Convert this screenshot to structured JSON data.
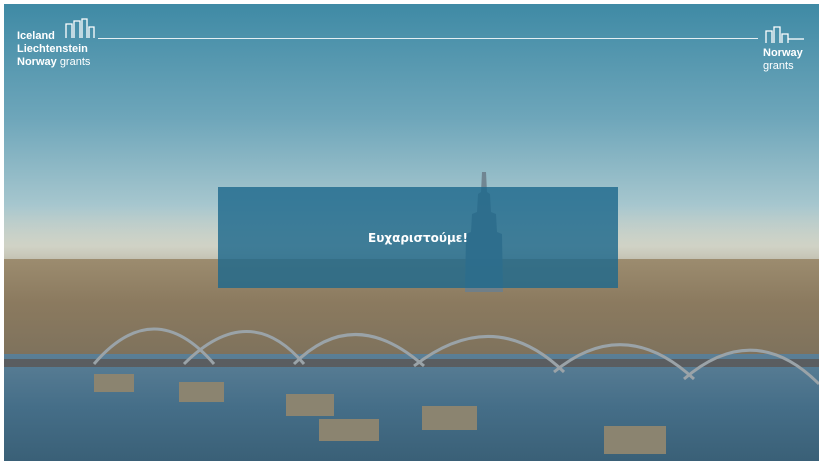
{
  "logo_left": {
    "line1": "Iceland",
    "line2": "Liechtenstein",
    "line3_bold": "Norway",
    "line3_rest": "grants"
  },
  "logo_right": {
    "country": "Norway",
    "grants": "grants"
  },
  "message": "Ευχαριστούμε!"
}
